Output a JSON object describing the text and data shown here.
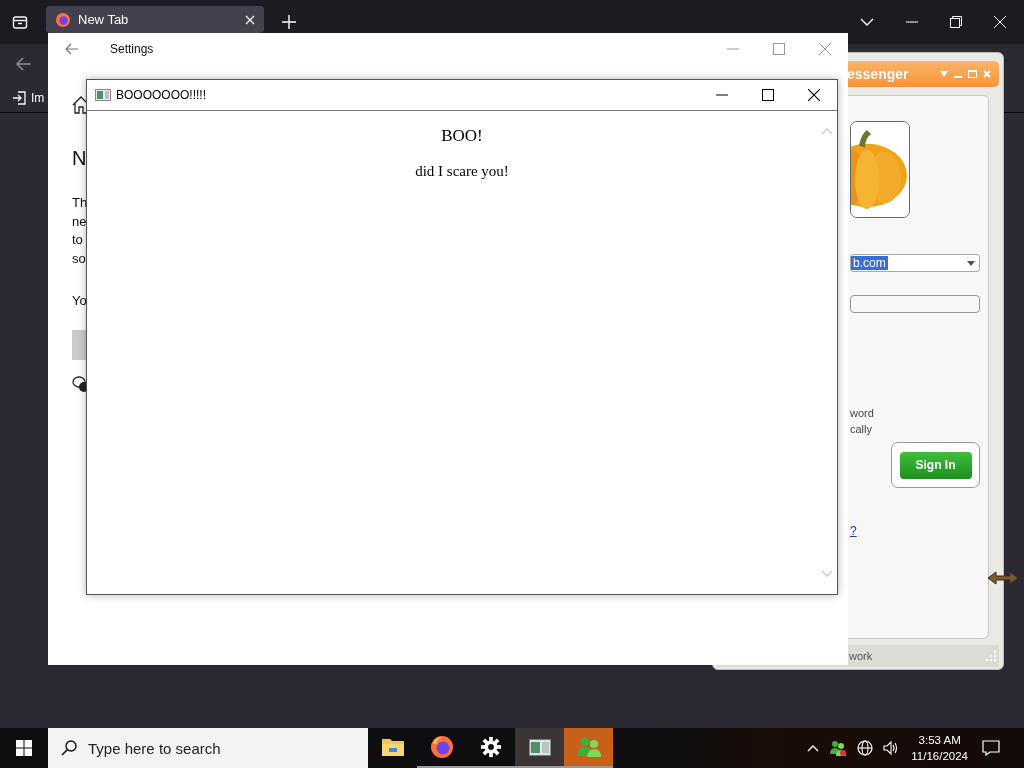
{
  "browser": {
    "tabs": [
      {
        "title": "New Tab",
        "selected": true
      }
    ],
    "bookmarks": [
      {
        "label": "Im"
      }
    ]
  },
  "settings_window": {
    "title": "Settings",
    "heading": "N",
    "lines": [
      "Th",
      "ne",
      "to",
      "so"
    ],
    "note": "Yo"
  },
  "messenger_window": {
    "title": "essenger",
    "account": "b.com",
    "options": [
      "word",
      "cally"
    ],
    "sign_in": "Sign In",
    "link": "?",
    "status": "work"
  },
  "popup": {
    "title": "BOOOOOOO!!!!!",
    "heading": "BOO!",
    "message": "did I scare you!"
  },
  "taskbar": {
    "search_placeholder": "Type here to search",
    "apps": [
      {
        "kind": "folder",
        "running": false,
        "selected": false,
        "flashing": false
      },
      {
        "kind": "firefox",
        "running": true,
        "selected": false,
        "flashing": false
      },
      {
        "kind": "settings",
        "running": true,
        "selected": false,
        "flashing": false
      },
      {
        "kind": "popup",
        "running": true,
        "selected": true,
        "flashing": false
      },
      {
        "kind": "messenger",
        "running": true,
        "selected": false,
        "flashing": true
      }
    ],
    "time": "3:53 AM",
    "date": "11/16/2024"
  }
}
